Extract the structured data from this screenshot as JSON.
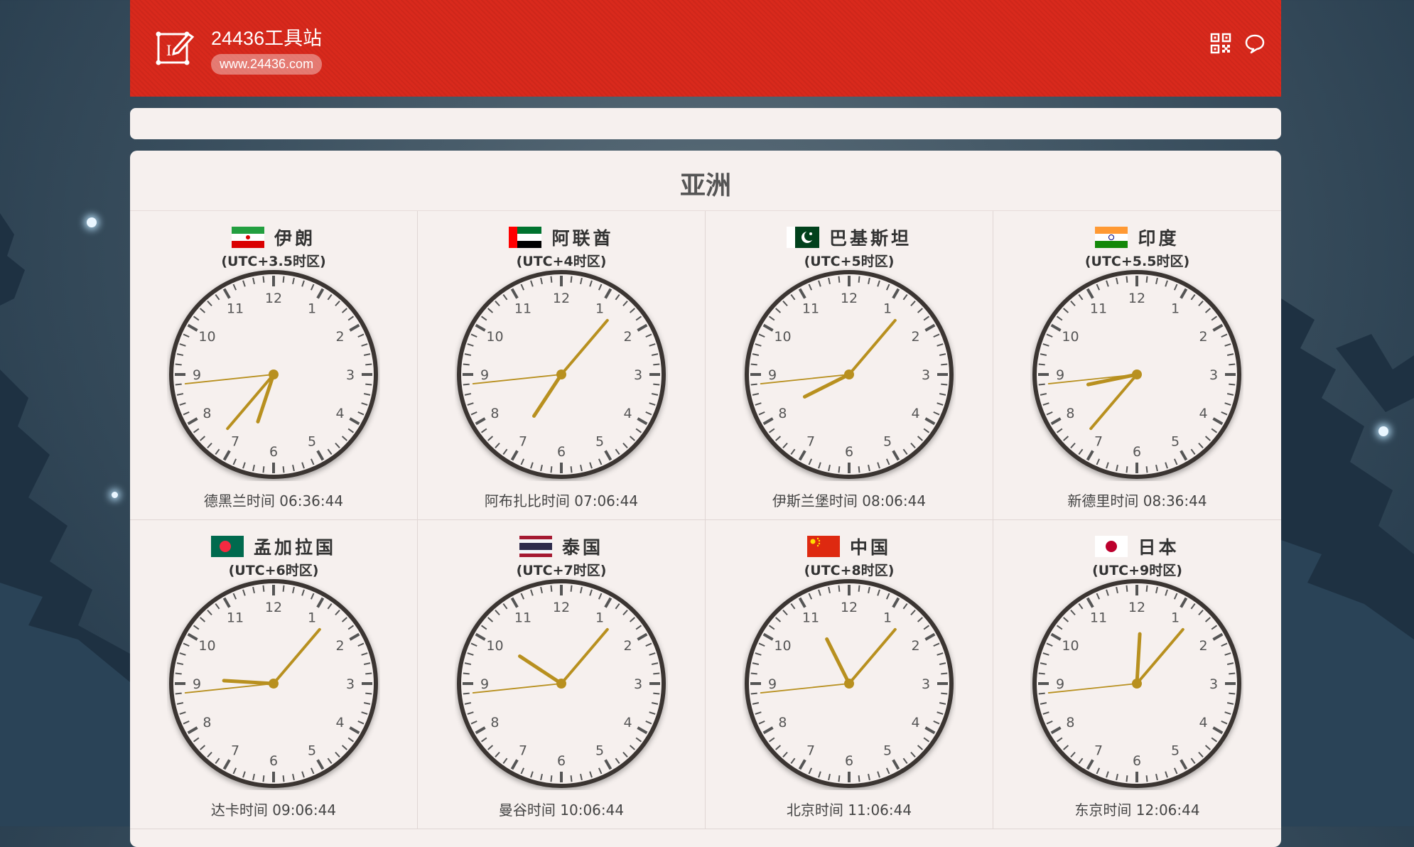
{
  "site": {
    "name": "24436工具站",
    "url": "www.24436.com"
  },
  "header_icons": [
    {
      "name": "qr-code-icon"
    },
    {
      "name": "comment-icon"
    }
  ],
  "section": {
    "title": "亚洲"
  },
  "clocks": [
    {
      "country": "伊朗",
      "tz": "(UTC+3.5时区)",
      "label": "德黑兰时间 06:36:44",
      "flag": "iran",
      "h": 6,
      "m": 36,
      "s": 44
    },
    {
      "country": "阿联酋",
      "tz": "(UTC+4时区)",
      "label": "阿布扎比时间 07:06:44",
      "flag": "uae",
      "h": 7,
      "m": 6,
      "s": 44
    },
    {
      "country": "巴基斯坦",
      "tz": "(UTC+5时区)",
      "label": "伊斯兰堡时间 08:06:44",
      "flag": "pakistan",
      "h": 8,
      "m": 6,
      "s": 44
    },
    {
      "country": "印度",
      "tz": "(UTC+5.5时区)",
      "label": "新德里时间 08:36:44",
      "flag": "india",
      "h": 8,
      "m": 36,
      "s": 44
    },
    {
      "country": "孟加拉国",
      "tz": "(UTC+6时区)",
      "label": "达卡时间 09:06:44",
      "flag": "bangladesh",
      "h": 9,
      "m": 6,
      "s": 44
    },
    {
      "country": "泰国",
      "tz": "(UTC+7时区)",
      "label": "曼谷时间 10:06:44",
      "flag": "thailand",
      "h": 10,
      "m": 6,
      "s": 44
    },
    {
      "country": "中国",
      "tz": "(UTC+8时区)",
      "label": "北京时间 11:06:44",
      "flag": "china",
      "h": 11,
      "m": 6,
      "s": 44
    },
    {
      "country": "日本",
      "tz": "(UTC+9时区)",
      "label": "东京时间 12:06:44",
      "flag": "japan",
      "h": 12,
      "m": 6,
      "s": 44
    }
  ],
  "colors": {
    "header": "#d9291c",
    "panel": "#f6f0ee",
    "hand": "#b8901f"
  }
}
